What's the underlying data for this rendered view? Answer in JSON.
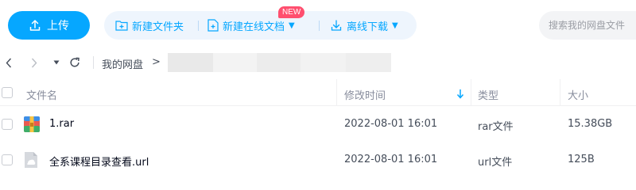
{
  "toolbar": {
    "upload_label": "上传",
    "new_folder_label": "新建文件夹",
    "new_online_doc_label": "新建在线文档",
    "new_badge": "NEW",
    "offline_download_label": "离线下载",
    "search_placeholder": "搜索我的网盘文件"
  },
  "breadcrumb": {
    "root": "我的网盘",
    "separator": ">"
  },
  "table": {
    "columns": [
      "文件名",
      "修改时间",
      "类型",
      "大小"
    ],
    "rows": [
      {
        "name": "1.rar",
        "modified": "2022-08-01 16:01",
        "type": "rar文件",
        "size": "15.38GB",
        "icon": "rar-archive-icon"
      },
      {
        "name": "全系课程目录查看.url",
        "modified": "2022-08-01 16:01",
        "type": "url文件",
        "size": "125B",
        "icon": "url-file-icon"
      }
    ]
  },
  "colors": {
    "accent": "#06a7ff",
    "badge": "#ff4f6f",
    "toolbar_bg": "#eef5fd"
  }
}
